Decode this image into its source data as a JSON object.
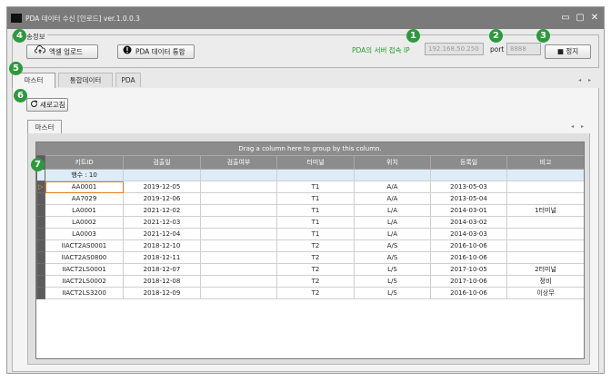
{
  "window": {
    "title": "PDA 데이터 수신 [인로드] ver.1.0.0.3",
    "controls": [
      "▭",
      "▢",
      "✕"
    ]
  },
  "top_group": {
    "caption": "송정보",
    "excel_upload_label": "엑셀 업로드",
    "pda_merge_label": "PDA 데이터 통합",
    "server_label": "PDA의 서버 접속 IP",
    "ip_value": "192.168.50.250",
    "port_label": "port",
    "port_value": "8888",
    "stop_label": "■ 정지"
  },
  "tabs": [
    "마스터",
    "통합데이터",
    "PDA"
  ],
  "refresh_label": "새로고침",
  "inner_tab": "마스터",
  "grid": {
    "group_hint": "Drag a column here to group by this column.",
    "columns": [
      "키트ID",
      "검출일",
      "검출여부",
      "터미널",
      "위치",
      "등록일",
      "비고"
    ],
    "summary": "행수 : 10",
    "rows": [
      [
        "AA0001",
        "2019-12-05",
        "",
        "T1",
        "A/A",
        "2013-05-03",
        ""
      ],
      [
        "AA7029",
        "2019-12-06",
        "",
        "T1",
        "A/A",
        "2013-05-04",
        ""
      ],
      [
        "LA0001",
        "2021-12-02",
        "",
        "T1",
        "L/A",
        "2014-03-01",
        "1터미널"
      ],
      [
        "LA0002",
        "2021-12-03",
        "",
        "T1",
        "L/A",
        "2014-03-02",
        ""
      ],
      [
        "LA0003",
        "2021-12-04",
        "",
        "T1",
        "L/A",
        "2014-03-03",
        ""
      ],
      [
        "IIACT2AS0001",
        "2018-12-10",
        "",
        "T2",
        "A/S",
        "2016-10-06",
        ""
      ],
      [
        "IIACT2AS0800",
        "2018-12-11",
        "",
        "T2",
        "A/S",
        "2016-10-06",
        ""
      ],
      [
        "IIACT2LS0001",
        "2018-12-07",
        "",
        "T2",
        "L/S",
        "2017-10-05",
        "2터미널"
      ],
      [
        "IIACT2LS0002",
        "2018-12-08",
        "",
        "T2",
        "L/S",
        "2017-10-06",
        "정비"
      ],
      [
        "IIACT2LS3200",
        "2018-12-09",
        "",
        "T2",
        "L/S",
        "2016-10-06",
        "이상무"
      ]
    ],
    "current_row_marker": "▷"
  },
  "badges": [
    "1",
    "2",
    "3",
    "4",
    "5",
    "6",
    "7"
  ],
  "colors": {
    "badge": "#2b9a3c",
    "server_label": "#27a327",
    "focus": "#e07b1a"
  },
  "icons": [
    "app-logo-icon",
    "cloud-upload-icon",
    "alert-icon",
    "refresh-icon"
  ]
}
